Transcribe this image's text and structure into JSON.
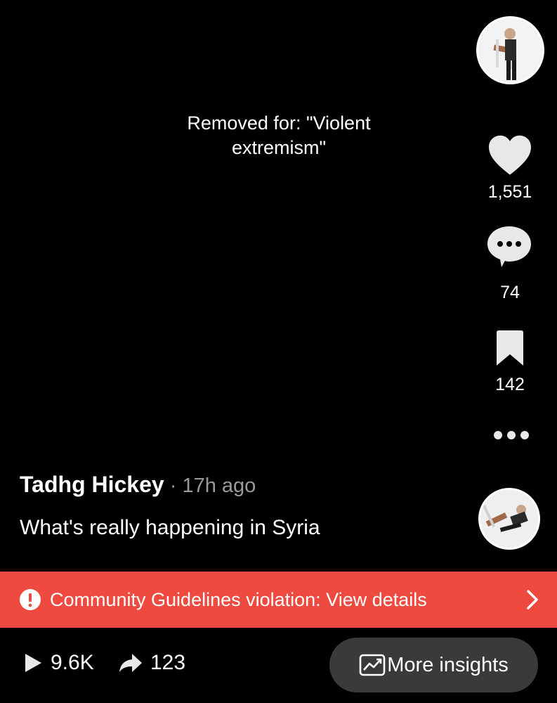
{
  "removed_notice": "Removed for: \"Violent\nextremism\"",
  "actions": {
    "like_count": "1,551",
    "comment_count": "74",
    "save_count": "142"
  },
  "post": {
    "author": "Tadhg Hickey",
    "separator": " · ",
    "time": "17h ago",
    "caption": "What's really happening in Syria"
  },
  "banner": {
    "text": "Community Guidelines violation: View details",
    "color": "#ee4a3f"
  },
  "stats": {
    "views": "9.6K",
    "shares": "123"
  },
  "insights_button": "More insights"
}
